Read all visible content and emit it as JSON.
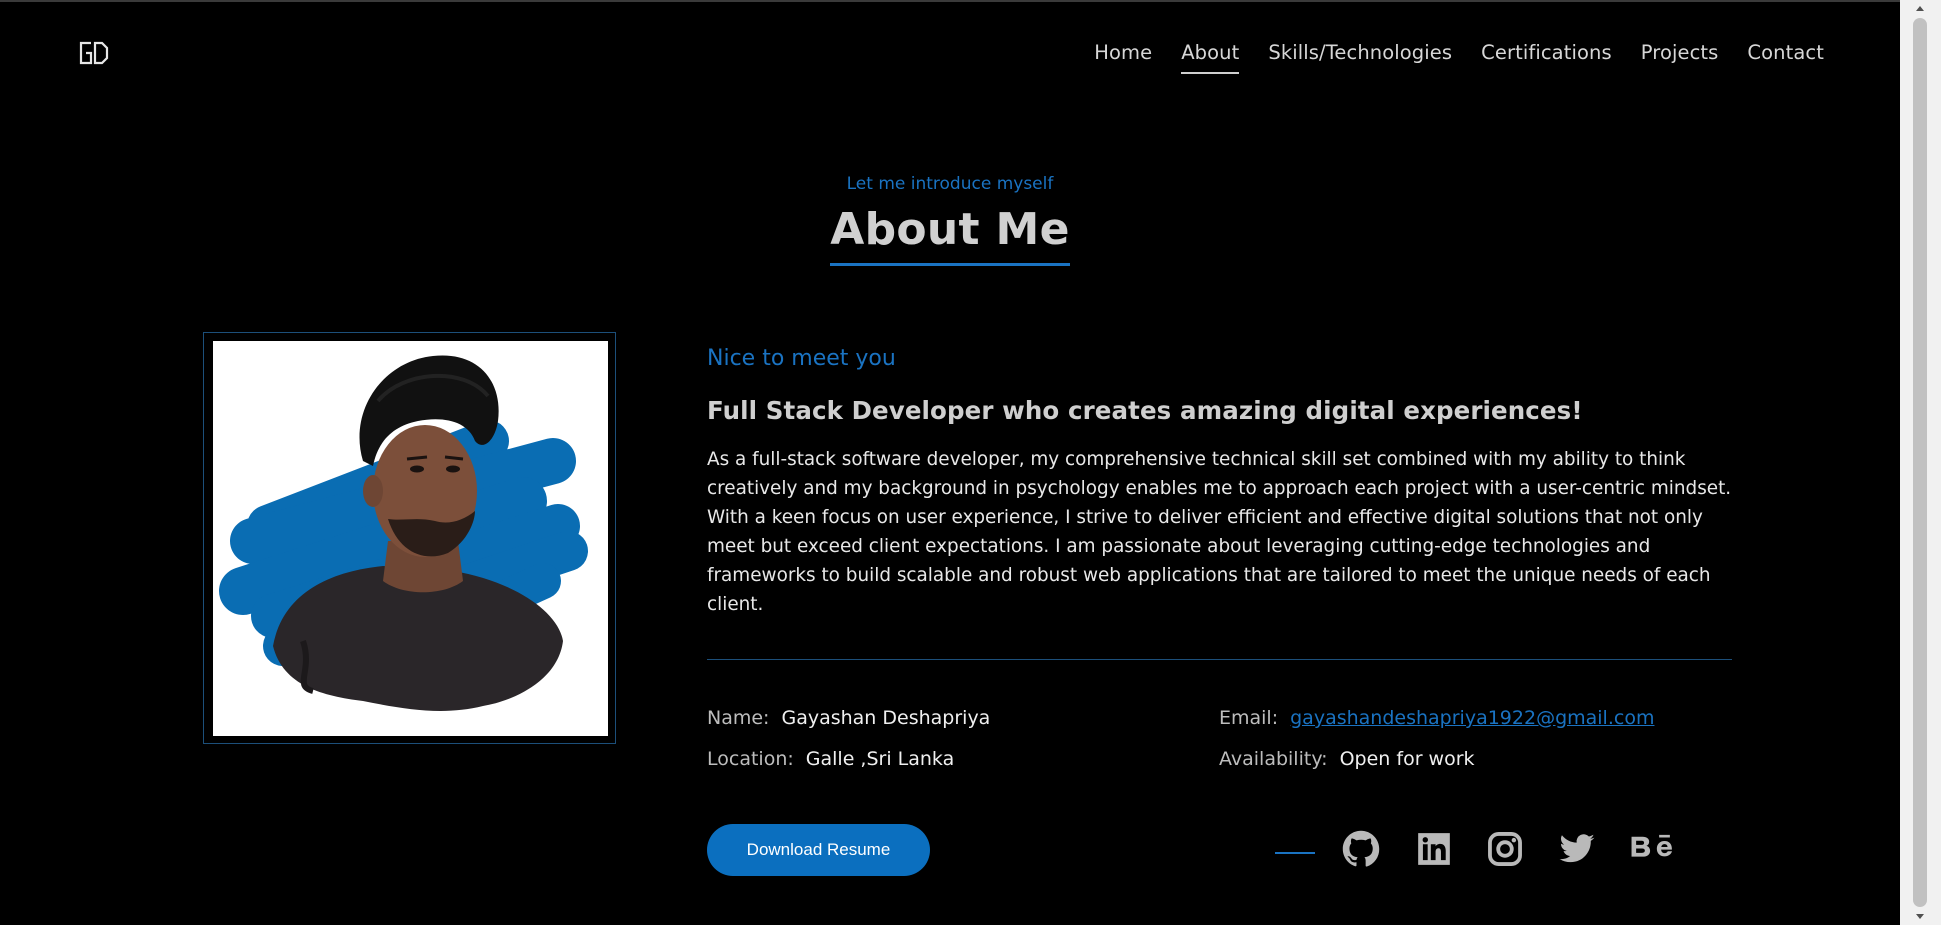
{
  "nav": {
    "logo": "GD",
    "items": [
      {
        "label": "Home",
        "active": false
      },
      {
        "label": "About",
        "active": true
      },
      {
        "label": "Skills/Technologies",
        "active": false
      },
      {
        "label": "Certifications",
        "active": false
      },
      {
        "label": "Projects",
        "active": false
      },
      {
        "label": "Contact",
        "active": false
      }
    ]
  },
  "about": {
    "intro": "Let me introduce myself",
    "title": "About Me",
    "greeting": "Nice to meet you",
    "headline": "Full Stack Developer who creates amazing digital experiences!",
    "bio": "As a full-stack software developer, my comprehensive technical skill set combined with my ability to think creatively and my background in psychology enables me to approach each project with a user-centric mindset. With a keen focus on user experience, I strive to deliver efficient and effective digital solutions that not only meet but exceed client expectations. I am passionate about leveraging cutting-edge technologies and frameworks to build scalable and robust web applications that are tailored to meet the unique needs of each client.",
    "info": {
      "name_label": "Name:",
      "name": "Gayashan Deshapriya",
      "location_label": "Location:",
      "location": "Galle ,Sri Lanka",
      "email_label": "Email:",
      "email": "gayashandeshapriya1922@gmail.com",
      "availability_label": "Availability:",
      "availability": "Open for work"
    },
    "download_button": "Download Resume"
  },
  "social": [
    "github-icon",
    "linkedin-icon",
    "instagram-icon",
    "twitter-icon",
    "behance-icon"
  ],
  "colors": {
    "accent": "#1a73c2",
    "background": "#000000",
    "button": "#0b6fbf"
  }
}
